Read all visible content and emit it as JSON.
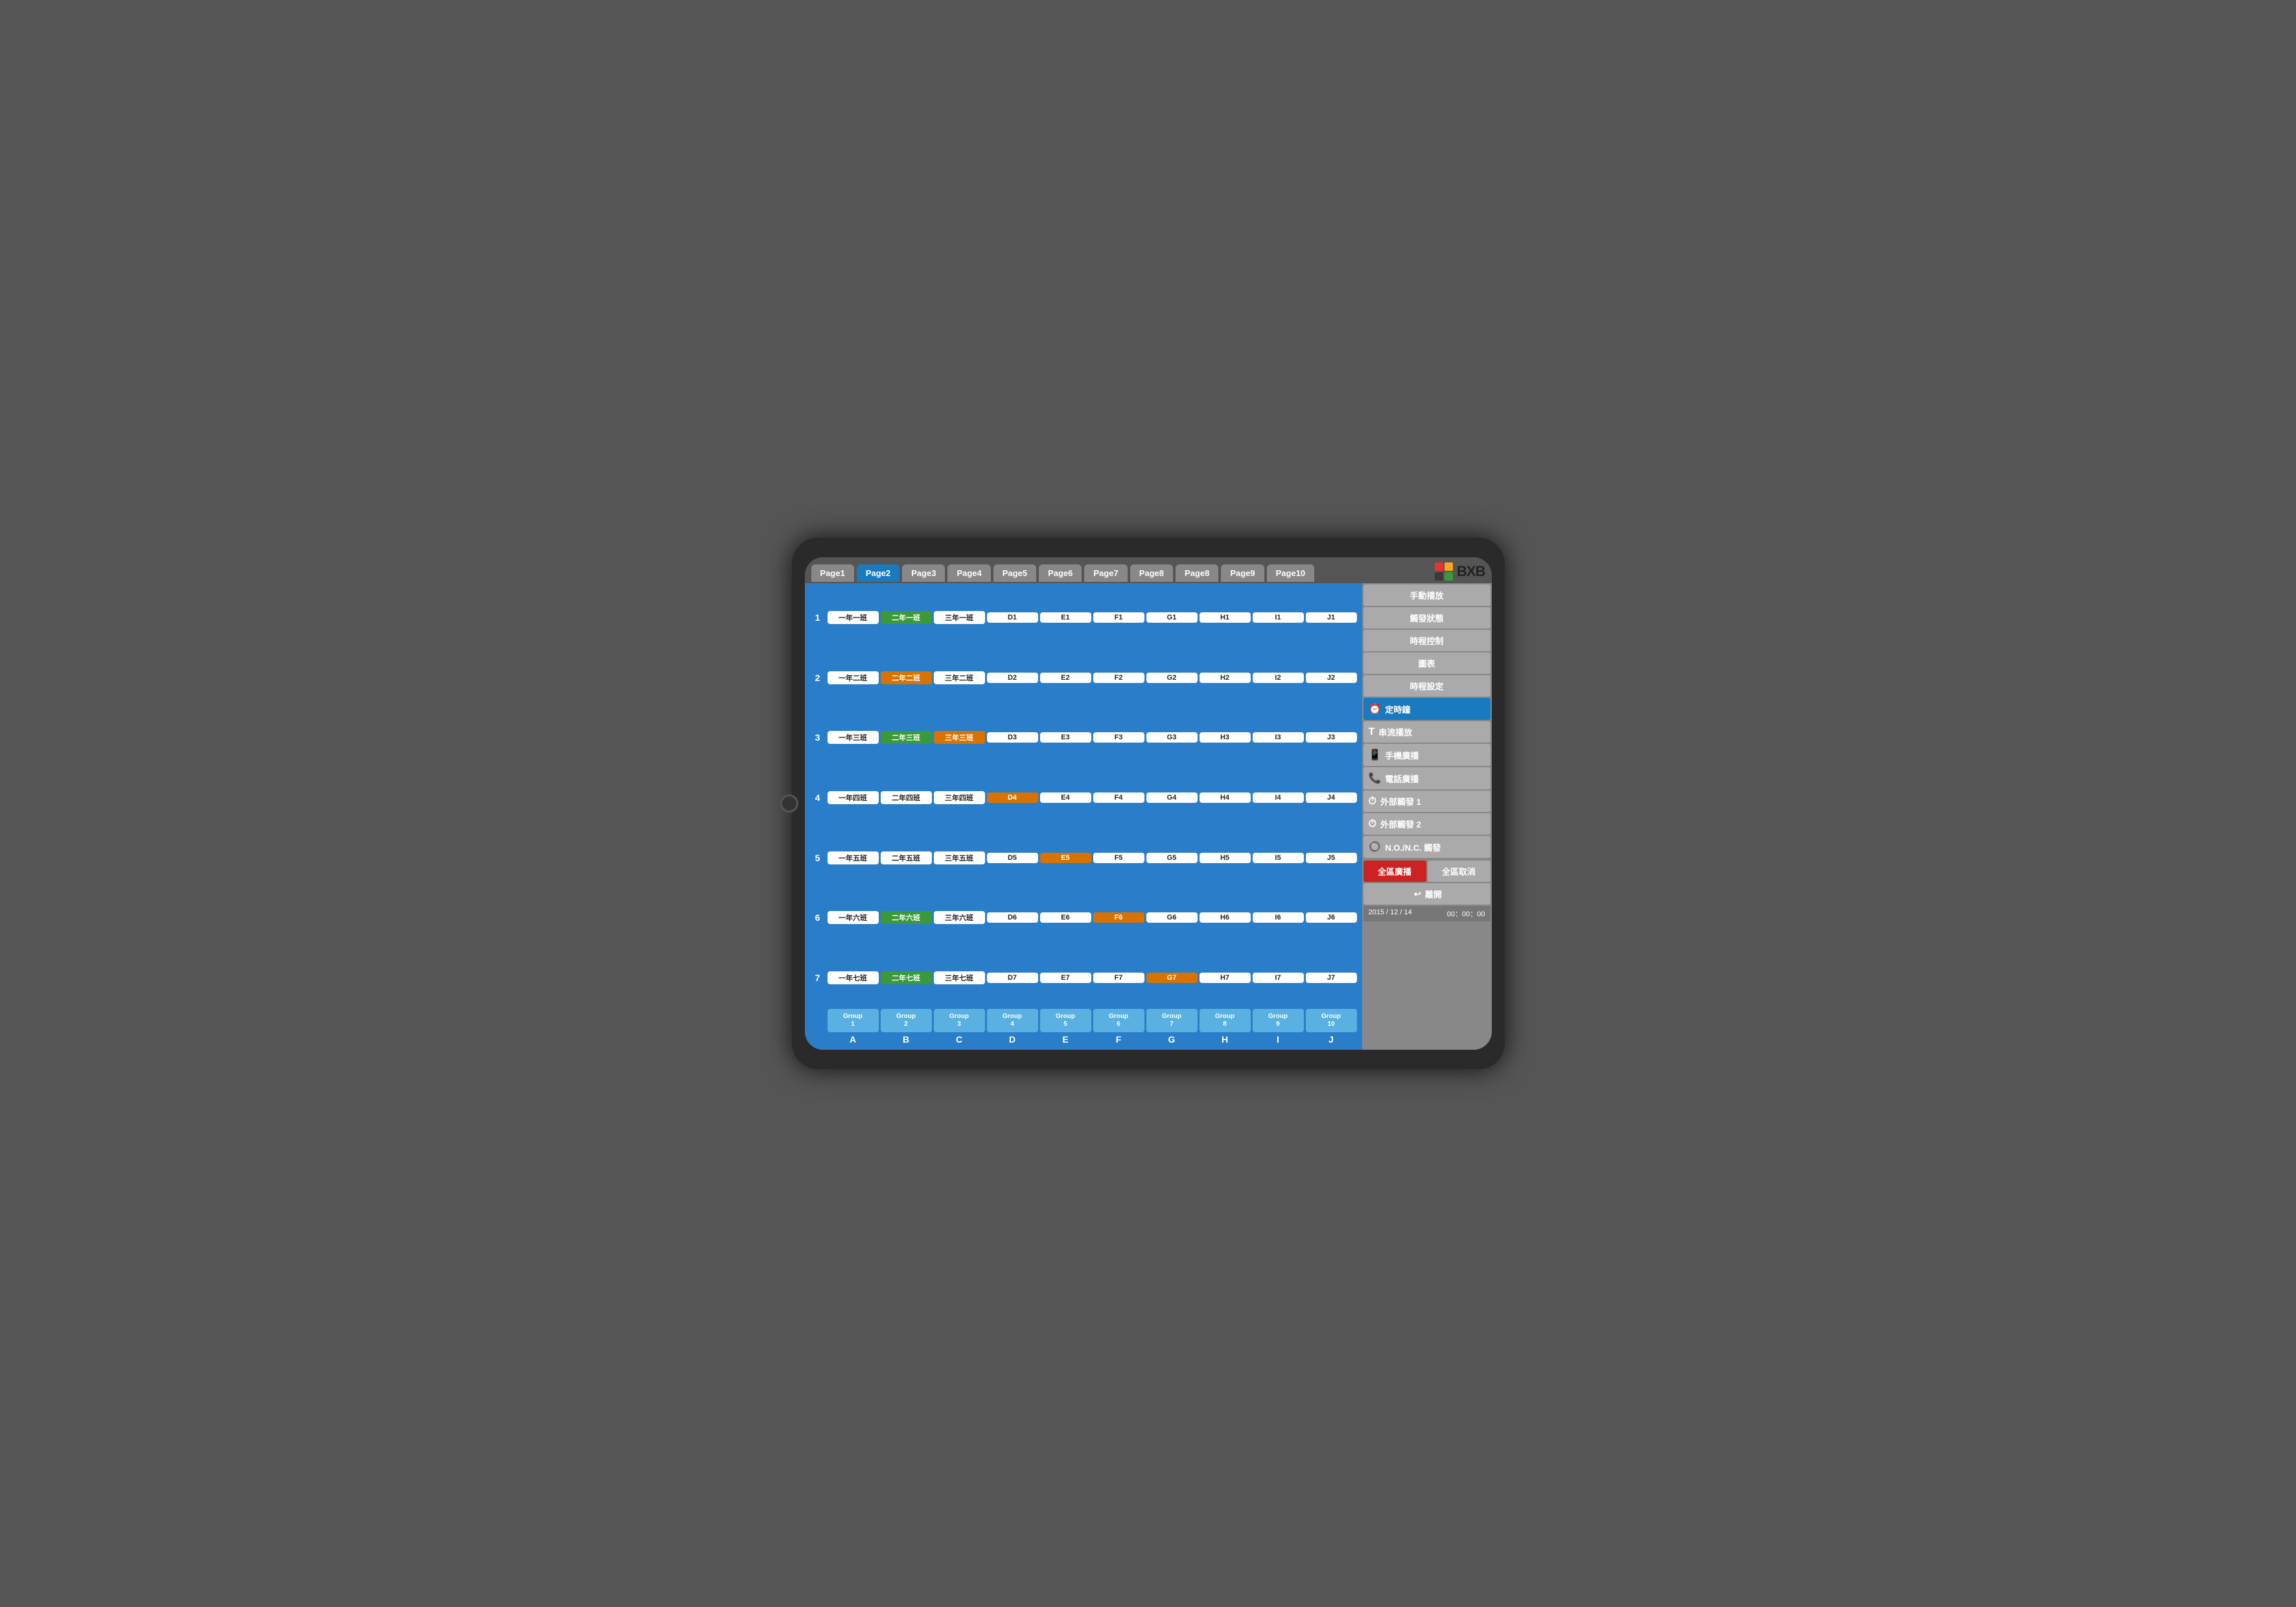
{
  "tabs": [
    {
      "label": "Page1",
      "active": false
    },
    {
      "label": "Page2",
      "active": true
    },
    {
      "label": "Page3",
      "active": false
    },
    {
      "label": "Page4",
      "active": false
    },
    {
      "label": "Page5",
      "active": false
    },
    {
      "label": "Page6",
      "active": false
    },
    {
      "label": "Page7",
      "active": false
    },
    {
      "label": "Page8",
      "active": false
    },
    {
      "label": "Page8",
      "active": false
    },
    {
      "label": "Page9",
      "active": false
    },
    {
      "label": "Page10",
      "active": false
    }
  ],
  "logo": {
    "text": "BXB",
    "colors": [
      "#e63333",
      "#f5a623",
      "#3a3a3a",
      "#3a9a3a"
    ]
  },
  "rows": [
    {
      "label": "1",
      "cells": [
        {
          "text": "一年一班",
          "color": "white"
        },
        {
          "text": "二年一班",
          "color": "green"
        },
        {
          "text": "三年一班",
          "color": "white"
        },
        {
          "text": "D1",
          "color": "white"
        },
        {
          "text": "E1",
          "color": "white"
        },
        {
          "text": "F1",
          "color": "white"
        },
        {
          "text": "G1",
          "color": "white"
        },
        {
          "text": "H1",
          "color": "white"
        },
        {
          "text": "I1",
          "color": "white"
        },
        {
          "text": "J1",
          "color": "white"
        }
      ]
    },
    {
      "label": "2",
      "cells": [
        {
          "text": "一年二班",
          "color": "white"
        },
        {
          "text": "二年二班",
          "color": "orange"
        },
        {
          "text": "三年二班",
          "color": "white"
        },
        {
          "text": "D2",
          "color": "white"
        },
        {
          "text": "E2",
          "color": "white"
        },
        {
          "text": "F2",
          "color": "white"
        },
        {
          "text": "G2",
          "color": "white"
        },
        {
          "text": "H2",
          "color": "white"
        },
        {
          "text": "I2",
          "color": "white"
        },
        {
          "text": "J2",
          "color": "white"
        }
      ]
    },
    {
      "label": "3",
      "cells": [
        {
          "text": "一年三班",
          "color": "white"
        },
        {
          "text": "二年三班",
          "color": "green"
        },
        {
          "text": "三年三班",
          "color": "orange"
        },
        {
          "text": "D3",
          "color": "white"
        },
        {
          "text": "E3",
          "color": "white"
        },
        {
          "text": "F3",
          "color": "white"
        },
        {
          "text": "G3",
          "color": "white"
        },
        {
          "text": "H3",
          "color": "white"
        },
        {
          "text": "I3",
          "color": "white"
        },
        {
          "text": "J3",
          "color": "white"
        }
      ]
    },
    {
      "label": "4",
      "cells": [
        {
          "text": "一年四班",
          "color": "white"
        },
        {
          "text": "二年四班",
          "color": "white"
        },
        {
          "text": "三年四班",
          "color": "white"
        },
        {
          "text": "D4",
          "color": "orange"
        },
        {
          "text": "E4",
          "color": "white"
        },
        {
          "text": "F4",
          "color": "white"
        },
        {
          "text": "G4",
          "color": "white"
        },
        {
          "text": "H4",
          "color": "white"
        },
        {
          "text": "I4",
          "color": "white"
        },
        {
          "text": "J4",
          "color": "white"
        }
      ]
    },
    {
      "label": "5",
      "cells": [
        {
          "text": "一年五班",
          "color": "white"
        },
        {
          "text": "二年五班",
          "color": "white"
        },
        {
          "text": "三年五班",
          "color": "white"
        },
        {
          "text": "D5",
          "color": "white"
        },
        {
          "text": "E5",
          "color": "orange"
        },
        {
          "text": "F5",
          "color": "white"
        },
        {
          "text": "G5",
          "color": "white"
        },
        {
          "text": "H5",
          "color": "white"
        },
        {
          "text": "I5",
          "color": "white"
        },
        {
          "text": "J5",
          "color": "white"
        }
      ]
    },
    {
      "label": "6",
      "cells": [
        {
          "text": "一年六班",
          "color": "white"
        },
        {
          "text": "二年六班",
          "color": "green"
        },
        {
          "text": "三年六班",
          "color": "white"
        },
        {
          "text": "D6",
          "color": "white"
        },
        {
          "text": "E6",
          "color": "white"
        },
        {
          "text": "F6",
          "color": "orange"
        },
        {
          "text": "G6",
          "color": "white"
        },
        {
          "text": "H6",
          "color": "white"
        },
        {
          "text": "I6",
          "color": "white"
        },
        {
          "text": "J6",
          "color": "white"
        }
      ]
    },
    {
      "label": "7",
      "cells": [
        {
          "text": "一年七班",
          "color": "white"
        },
        {
          "text": "二年七班",
          "color": "green"
        },
        {
          "text": "三年七班",
          "color": "white"
        },
        {
          "text": "D7",
          "color": "white"
        },
        {
          "text": "E7",
          "color": "white"
        },
        {
          "text": "F7",
          "color": "white"
        },
        {
          "text": "G7",
          "color": "orange"
        },
        {
          "text": "H7",
          "color": "white"
        },
        {
          "text": "I7",
          "color": "white"
        },
        {
          "text": "J7",
          "color": "white"
        }
      ]
    }
  ],
  "groups": [
    {
      "label": "Group\n1"
    },
    {
      "label": "Group\n2"
    },
    {
      "label": "Group\n3"
    },
    {
      "label": "Group\n4"
    },
    {
      "label": "Group\n5"
    },
    {
      "label": "Group\n6"
    },
    {
      "label": "Group\n7"
    },
    {
      "label": "Group\n8"
    },
    {
      "label": "Group\n9"
    },
    {
      "label": "Group\n10"
    }
  ],
  "col_labels": [
    "A",
    "B",
    "C",
    "D",
    "E",
    "F",
    "G",
    "H",
    "I",
    "J"
  ],
  "sidebar": {
    "buttons": [
      {
        "label": "手動播放",
        "active": false,
        "icon": null
      },
      {
        "label": "觸發狀態",
        "active": false,
        "icon": null
      },
      {
        "label": "時程控制",
        "active": false,
        "icon": null
      },
      {
        "label": "圖表",
        "active": false,
        "icon": null
      },
      {
        "label": "時程設定",
        "active": false,
        "icon": null
      },
      {
        "label": "定時鐘",
        "active": true,
        "icon": "⏰"
      },
      {
        "label": "串流播放",
        "active": false,
        "icon": "T"
      },
      {
        "label": "手機廣播",
        "active": false,
        "icon": "📱"
      },
      {
        "label": "電話廣播",
        "active": false,
        "icon": "📞"
      },
      {
        "label": "外部觸發 1",
        "active": false,
        "icon": "⏱"
      },
      {
        "label": "外部觸發 2",
        "active": false,
        "icon": "⏱"
      },
      {
        "label": "N.O./N.C. 觸發",
        "active": false,
        "icon": "🔘"
      }
    ],
    "btn_broadcast": "全區廣播",
    "btn_cancel": "全區取消",
    "btn_exit": "離開",
    "status_date": "2015 / 12 / 14",
    "status_time": "00：00：00"
  }
}
